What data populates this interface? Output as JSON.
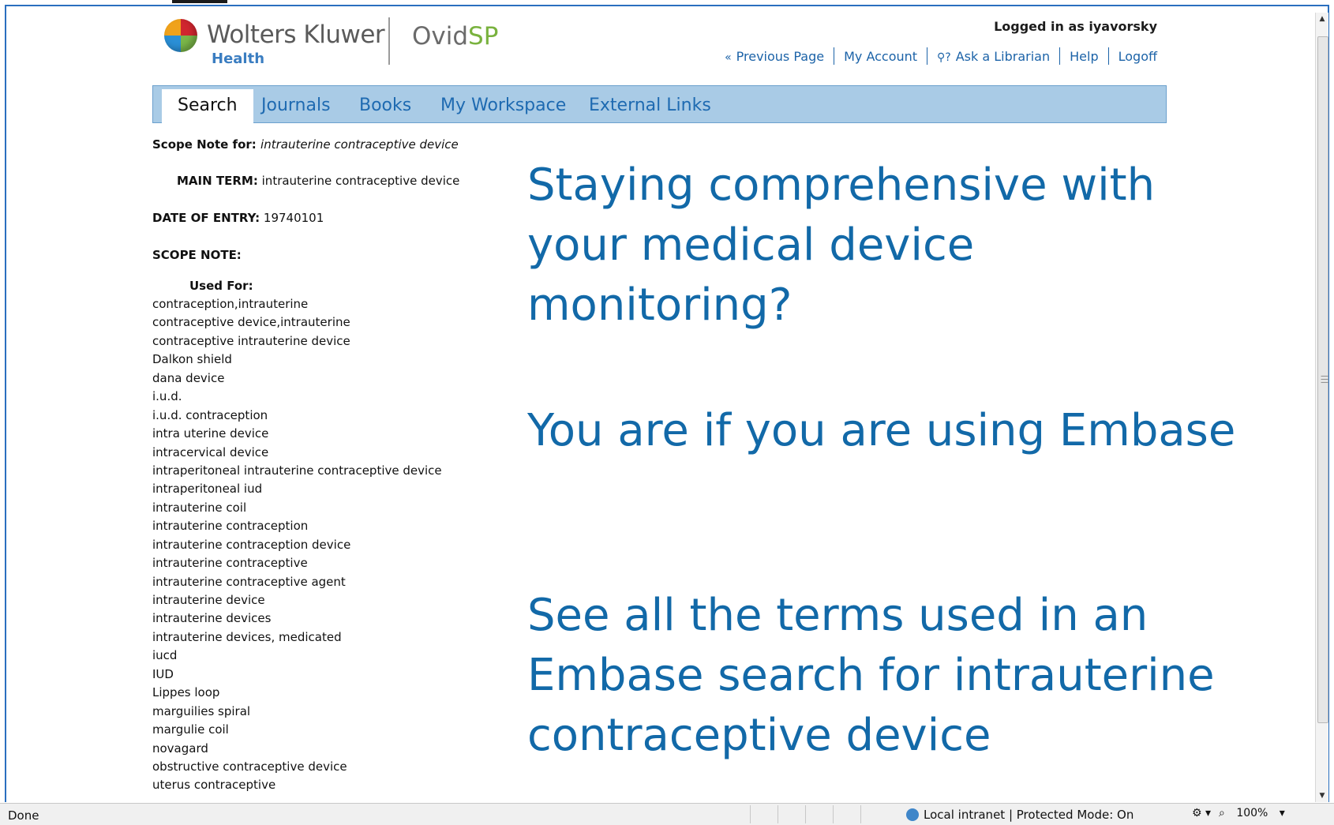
{
  "header": {
    "brand": "Wolters Kluwer",
    "brand_sub": "Health",
    "product_prefix": "Ovid",
    "product_suffix": "SP",
    "logged_in": "Logged in as iyavorsky",
    "links": {
      "previous_page": "Previous Page",
      "my_account": "My Account",
      "ask_librarian": "Ask a Librarian",
      "help": "Help",
      "logoff": "Logoff"
    }
  },
  "nav": {
    "tabs": [
      "Search",
      "Journals",
      "Books",
      "My Workspace",
      "External Links"
    ],
    "active": "Search"
  },
  "scope": {
    "title_label": "Scope Note for:",
    "title_term": "intrauterine contraceptive device",
    "main_term_label": "MAIN TERM:",
    "main_term_value": "intrauterine contraceptive device",
    "date_label": "DATE OF ENTRY:",
    "date_value": "19740101",
    "scope_note_label": "SCOPE NOTE:",
    "used_for_label": "Used For:",
    "used_for": [
      "contraception,intrauterine",
      "contraceptive device,intrauterine",
      "contraceptive intrauterine device",
      "Dalkon shield",
      "dana device",
      "i.u.d.",
      "i.u.d. contraception",
      "intra uterine device",
      "intracervical device",
      "intraperitoneal intrauterine contraceptive device",
      "intraperitoneal iud",
      "intrauterine coil",
      "intrauterine contraception",
      "intrauterine contraception device",
      "intrauterine contraceptive",
      "intrauterine contraceptive agent",
      "intrauterine device",
      "intrauterine devices",
      "intrauterine devices, medicated",
      "iucd",
      "IUD",
      "Lippes loop",
      "marguilies spiral",
      "margulie coil",
      "novagard",
      "obstructive contraceptive device",
      "uterus contraceptive"
    ]
  },
  "overlay": {
    "line1": "Staying comprehensive with your medical device monitoring?",
    "line2": "You are if you are using Embase",
    "line3": "See all the terms used in an Embase search for intrauterine contraceptive device"
  },
  "statusbar": {
    "left": "Done",
    "zone": "Local intranet | Protected Mode: On",
    "zoom": "100%"
  },
  "colors": {
    "accent": "#1269a8",
    "nav_bg": "#a9cbe6",
    "link": "#1c63a8"
  }
}
